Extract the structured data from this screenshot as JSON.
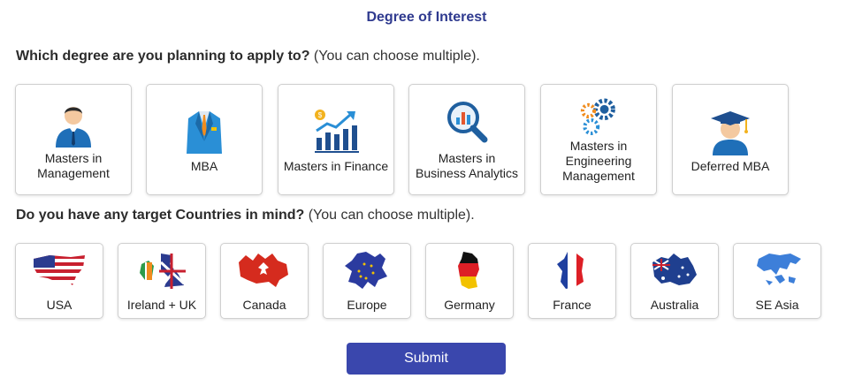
{
  "title": "Degree of Interest",
  "degree_question": {
    "bold": "Which degree are you planning to apply to?",
    "hint": " (You can choose multiple)."
  },
  "degrees": [
    {
      "label_lines": [
        "Masters in",
        "Management"
      ],
      "icon": "manager-person-icon"
    },
    {
      "label_lines": [
        "MBA"
      ],
      "icon": "business-suit-icon"
    },
    {
      "label_lines": [
        "Masters in Finance"
      ],
      "icon": "finance-chart-icon"
    },
    {
      "label_lines": [
        "Masters in",
        "Business Analytics"
      ],
      "icon": "analytics-magnifier-icon"
    },
    {
      "label_lines": [
        "Masters in",
        "Engineering",
        "Management"
      ],
      "icon": "gears-icon"
    },
    {
      "label_lines": [
        "Deferred MBA"
      ],
      "icon": "graduate-cap-icon"
    }
  ],
  "country_question": {
    "bold": "Do you have any target Countries in mind?",
    "hint": " (You can choose multiple)."
  },
  "countries": [
    {
      "label": "USA",
      "icon": "usa-flag-map-icon"
    },
    {
      "label": "Ireland + UK",
      "icon": "ireland-uk-flag-map-icon"
    },
    {
      "label": "Canada",
      "icon": "canada-flag-map-icon"
    },
    {
      "label": "Europe",
      "icon": "europe-flag-map-icon"
    },
    {
      "label": "Germany",
      "icon": "germany-flag-map-icon"
    },
    {
      "label": "France",
      "icon": "france-flag-map-icon"
    },
    {
      "label": "Australia",
      "icon": "australia-flag-map-icon"
    },
    {
      "label": "SE Asia",
      "icon": "se-asia-map-icon"
    }
  ],
  "submit_label": "Submit",
  "colors": {
    "title": "#2f3a8f",
    "submit_bg": "#3a47ad",
    "card_border": "#cfcfcf"
  }
}
